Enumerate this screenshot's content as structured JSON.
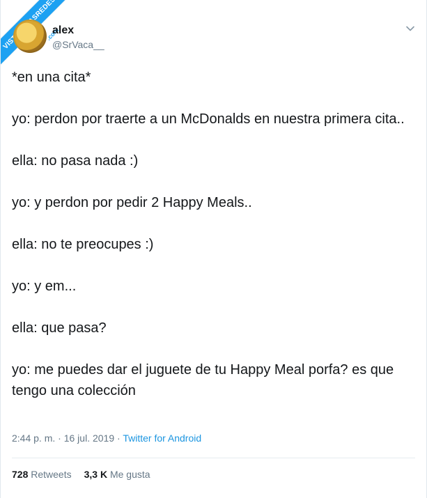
{
  "watermark": {
    "text": "VISTOENLASREDES",
    "suffix": ".com"
  },
  "tweet": {
    "author_name": "alex",
    "author_handle": "@SrVaca__",
    "lines": [
      "*en una cita*",
      "yo: perdon por traerte a un McDonalds en nuestra primera cita..",
      "ella: no pasa nada :)",
      "yo: y perdon por pedir 2 Happy Meals..",
      "ella: no te preocupes :)",
      "yo: y em...",
      "ella: que pasa?",
      "yo: me puedes dar el juguete de tu Happy Meal porfa? es que tengo una colección"
    ],
    "time": "2:44 p. m.",
    "date": "16 jul. 2019",
    "separator": " · ",
    "client": "Twitter for Android",
    "retweets_count": "728",
    "retweets_label": "Retweets",
    "likes_count": "3,3 K",
    "likes_label": "Me gusta"
  },
  "colors": {
    "accent": "#1da1f2",
    "link": "#1b95e0",
    "secondary_text": "#657786",
    "text": "#14171a"
  }
}
